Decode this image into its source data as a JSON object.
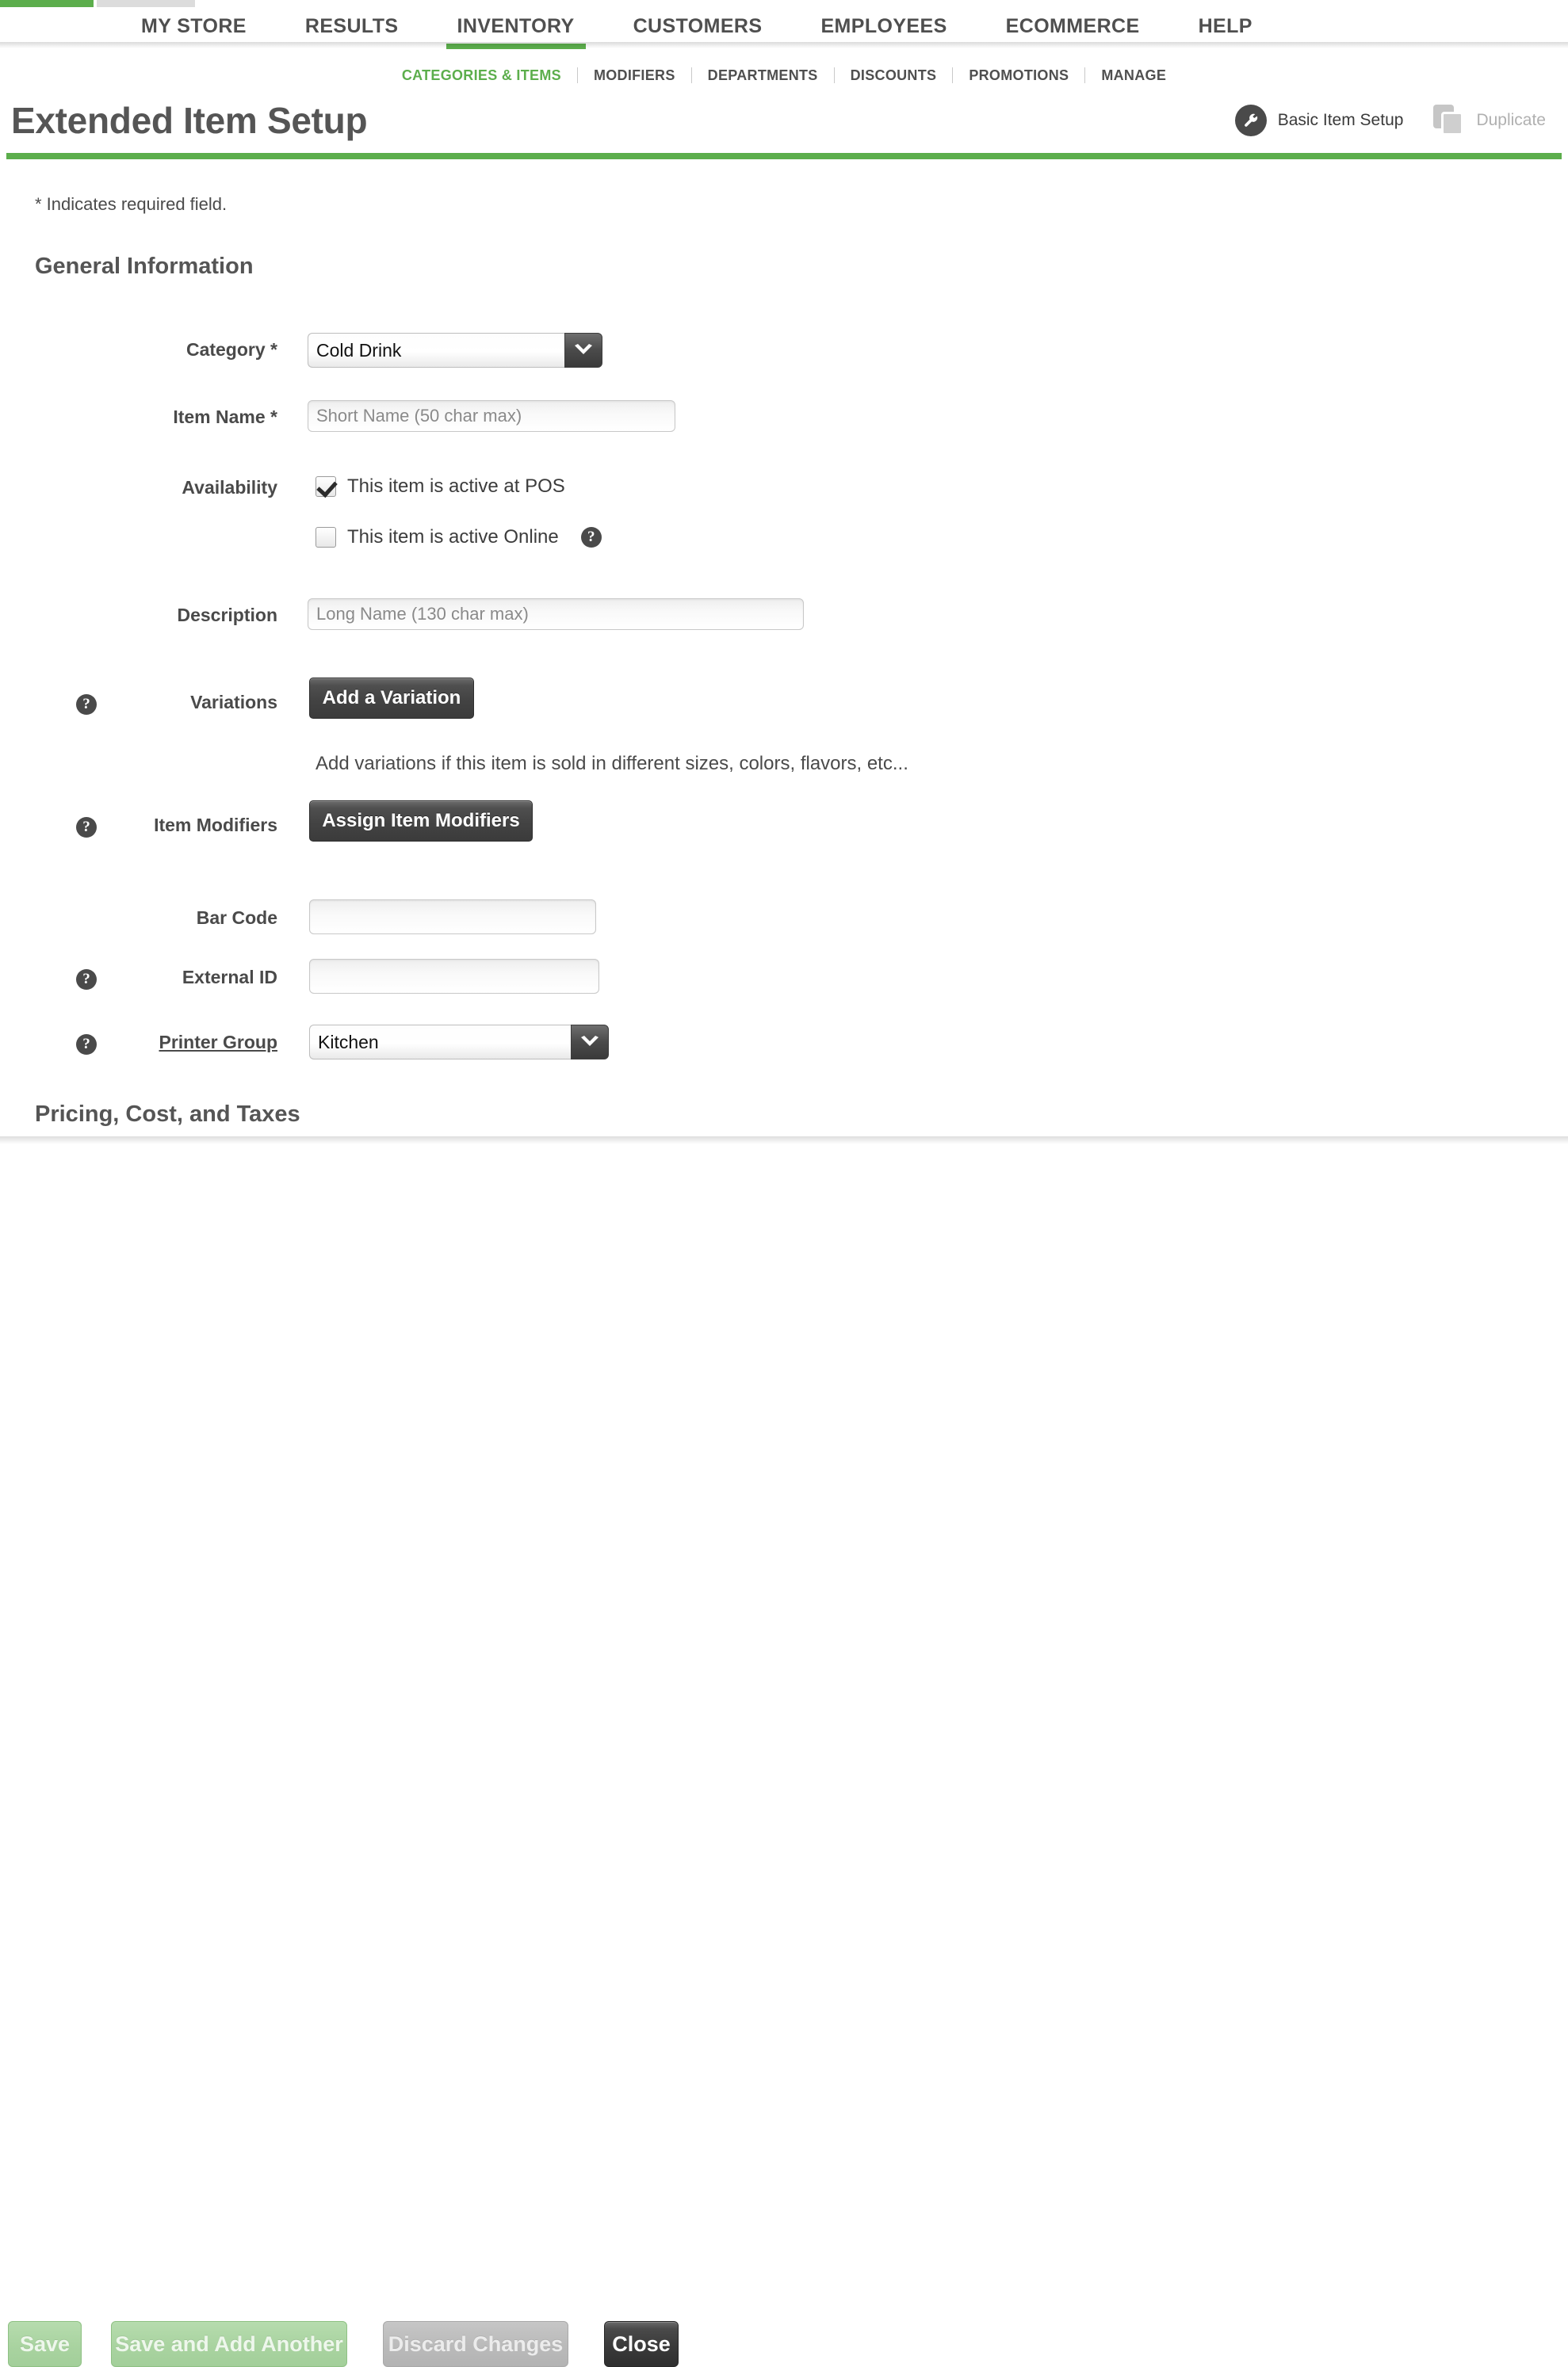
{
  "mainnav": {
    "items": [
      {
        "label": "MY STORE",
        "active": false
      },
      {
        "label": "RESULTS",
        "active": false
      },
      {
        "label": "INVENTORY",
        "active": true
      },
      {
        "label": "CUSTOMERS",
        "active": false
      },
      {
        "label": "EMPLOYEES",
        "active": false
      },
      {
        "label": "ECOMMERCE",
        "active": false
      },
      {
        "label": "HELP",
        "active": false
      }
    ]
  },
  "subnav": {
    "items": [
      {
        "label": "CATEGORIES & ITEMS",
        "active": true
      },
      {
        "label": "MODIFIERS",
        "active": false
      },
      {
        "label": "DEPARTMENTS",
        "active": false
      },
      {
        "label": "DISCOUNTS",
        "active": false
      },
      {
        "label": "PROMOTIONS",
        "active": false
      },
      {
        "label": "MANAGE",
        "active": false
      }
    ]
  },
  "header": {
    "title": "Extended Item Setup",
    "basic_item_setup": "Basic Item Setup",
    "duplicate": "Duplicate",
    "accent_color": "#5cae4c"
  },
  "form": {
    "required_note": "* Indicates required field.",
    "section_general": "General Information",
    "section_pricing": "Pricing, Cost, and Taxes",
    "category": {
      "label": "Category *",
      "value": "Cold Drink"
    },
    "item_name": {
      "label": "Item Name *",
      "value": "",
      "placeholder": "Short Name (50 char max)"
    },
    "availability": {
      "label": "Availability",
      "pos_label": "This item is active at POS",
      "pos_checked": true,
      "online_label": "This item is active Online",
      "online_checked": false
    },
    "description": {
      "label": "Description",
      "value": "",
      "placeholder": "Long Name (130 char max)"
    },
    "variations": {
      "label": "Variations",
      "button": "Add a Variation",
      "hint": "Add variations if this item is sold in different sizes, colors, flavors, etc..."
    },
    "item_modifiers": {
      "label": "Item Modifiers",
      "button": "Assign Item Modifiers"
    },
    "bar_code": {
      "label": "Bar Code",
      "value": ""
    },
    "external_id": {
      "label": "External ID",
      "value": ""
    },
    "printer_group": {
      "label": "Printer Group",
      "value": "Kitchen"
    },
    "help_glyph": "?"
  },
  "footer": {
    "save": "Save",
    "save_add_another": "Save and Add Another",
    "discard": "Discard Changes",
    "close": "Close"
  }
}
